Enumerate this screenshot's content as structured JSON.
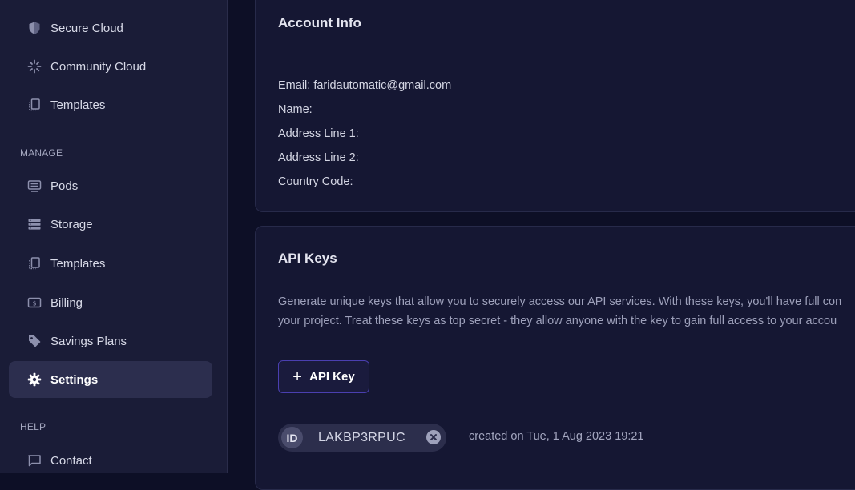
{
  "sidebar": {
    "top_items": [
      {
        "label": "Secure Cloud",
        "icon": "shield-icon"
      },
      {
        "label": "Community Cloud",
        "icon": "community-icon"
      },
      {
        "label": "Templates",
        "icon": "templates-icon"
      }
    ],
    "manage_label": "MANAGE",
    "manage_items": [
      {
        "label": "Pods",
        "icon": "pods-icon"
      },
      {
        "label": "Storage",
        "icon": "storage-icon"
      },
      {
        "label": "Templates",
        "icon": "templates-icon"
      },
      {
        "label": "Billing",
        "icon": "billing-icon"
      },
      {
        "label": "Savings Plans",
        "icon": "tag-icon"
      },
      {
        "label": "Settings",
        "icon": "gear-icon",
        "active": true
      }
    ],
    "help_label": "HELP",
    "help_items": [
      {
        "label": "Contact",
        "icon": "chat-icon"
      }
    ]
  },
  "account_info": {
    "title": "Account Info",
    "email": "Email: faridautomatic@gmail.com",
    "name": "Name:",
    "address1": "Address Line 1:",
    "address2": "Address Line 2:",
    "country": "Country Code:"
  },
  "api_keys": {
    "title": "API Keys",
    "description_line1": "Generate unique keys that allow you to securely access our API services. With these keys, you'll have full con",
    "description_line2": "your project. Treat these keys as top secret - they allow anyone with the key to gain full access to your accou",
    "add_button_label": "API Key",
    "add_button_icon": "plus-icon",
    "keys": [
      {
        "id_badge": "ID",
        "value": "LAKBP3RPUC",
        "created": "created on Tue, 1 Aug 2023 19:21"
      }
    ]
  },
  "colors": {
    "background": "#0d0f26",
    "sidebar": "#1a1c37",
    "card": "#151733",
    "accent_border": "#4a3fb0",
    "active_item": "#2c2e4e"
  }
}
